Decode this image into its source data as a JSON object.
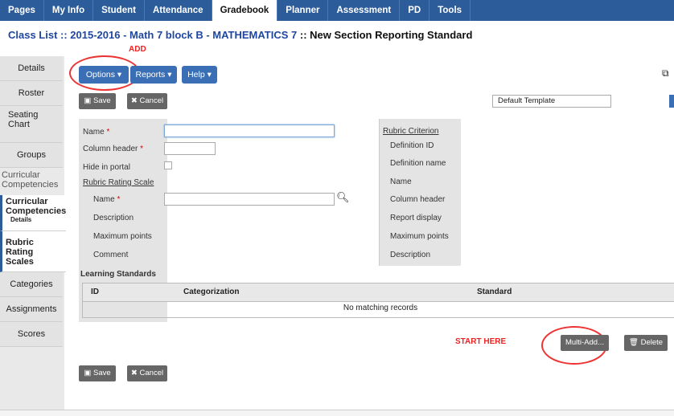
{
  "topnav": [
    "Pages",
    "My Info",
    "Student",
    "Attendance",
    "Gradebook",
    "Planner",
    "Assessment",
    "PD",
    "Tools"
  ],
  "active_tab": "Gradebook",
  "title": {
    "prefix": "Class List :: 2015-2016 - Math 7 block B - MATHEMATICS 7",
    "current": ":: New Section Reporting Standard"
  },
  "sidebar": {
    "details": "Details",
    "roster": "Roster",
    "seating": "Seating Chart",
    "groups": "Groups",
    "curricular_header": "Curricular Competencies",
    "curricular_item": "Curricular Competencies",
    "curricular_sub": "Details",
    "rubric": "Rubric Rating Scales",
    "categories": "Categories",
    "assignments": "Assignments",
    "scores": "Scores"
  },
  "toolbar": {
    "options": "Options ▾",
    "reports": "Reports ▾",
    "help": "Help ▾",
    "add_note": "ADD"
  },
  "actions": {
    "save": "Save",
    "cancel": "Cancel"
  },
  "template": {
    "value": "Default Template"
  },
  "form": {
    "name": "Name",
    "column_header": "Column header",
    "hide_in_portal": "Hide in portal",
    "rubric_scale_link": "Rubric Rating Scale",
    "scale_name": "Name",
    "description": "Description",
    "maximum_points": "Maximum points",
    "comment": "Comment"
  },
  "rubric": {
    "criterion_link": "Rubric Criterion",
    "definition_id": "Definition ID",
    "definition_name": "Definition name",
    "name": "Name",
    "column_header": "Column header",
    "report_display": "Report display",
    "maximum_points": "Maximum points",
    "description": "Description"
  },
  "learning_standards": {
    "heading": "Learning Standards",
    "columns": [
      "ID",
      "Categorization",
      "Standard"
    ],
    "empty": "No matching records"
  },
  "bottom": {
    "start_here": "START HERE",
    "multi_add": "Multi-Add...",
    "delete": "Delete"
  },
  "colors": {
    "nav": "#2c5d9a",
    "button_blue": "#3a6fb5",
    "annotation_red": "#e33"
  }
}
